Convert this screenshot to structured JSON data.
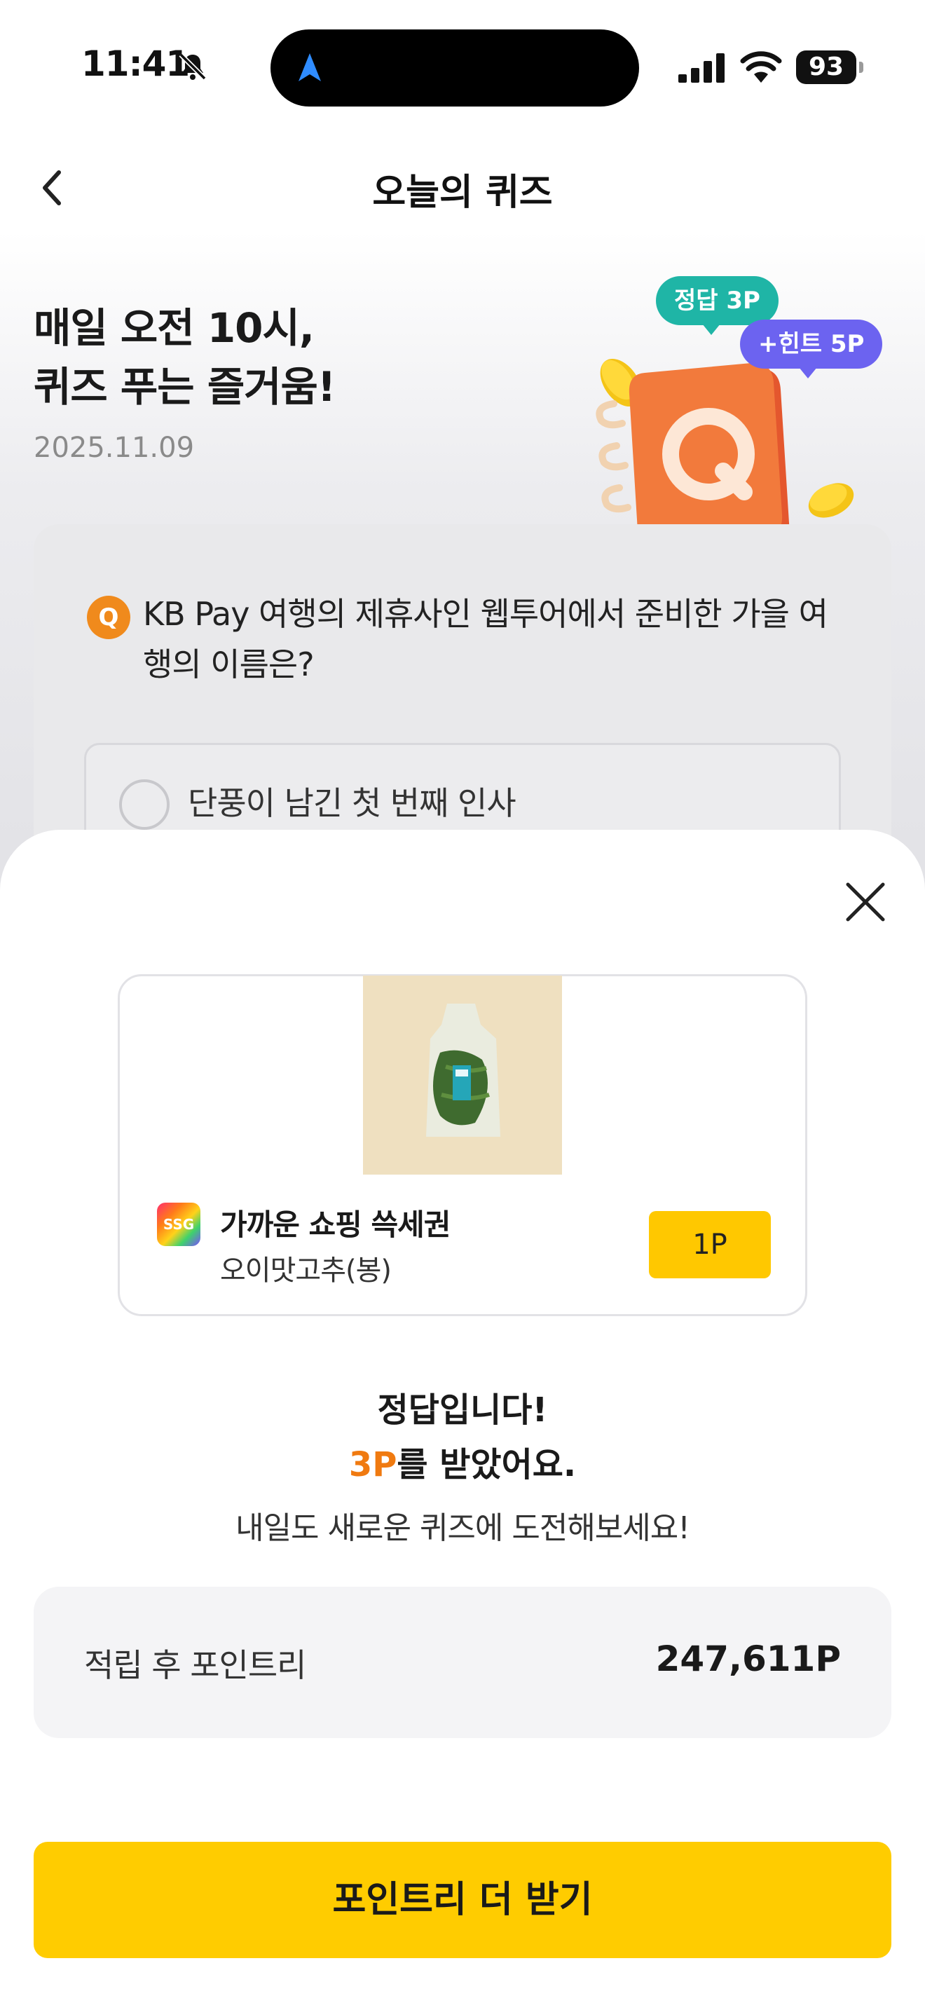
{
  "status_bar": {
    "time": "11:41",
    "battery": "93"
  },
  "header": {
    "title": "오늘의 퀴즈"
  },
  "hero": {
    "title_line1": "매일 오전 10시,",
    "title_line2": "퀴즈 푸는 즐거움!",
    "date": "2025.11.09",
    "bubble_answer": "정답 3P",
    "bubble_hint": "+힌트 5P",
    "book_letter": "Q"
  },
  "quiz": {
    "badge": "Q",
    "question": "KB Pay 여행의 제휴사인 웹투어에서 준비한 가을 여행의 이름은?",
    "option_1": "단풍이 남긴 첫 번째 인사"
  },
  "reward": {
    "logo_text": "SSG",
    "brand": "가까운 쇼핑 쓱세권",
    "product": "오이맛고추(봉)",
    "price": "1P"
  },
  "result": {
    "line1": "정답입니다!",
    "points": "3P",
    "line2_suffix": "를 받았어요.",
    "line3": "내일도 새로운 퀴즈에 도전해보세요!"
  },
  "points_summary": {
    "label": "적립 후 포인트리",
    "value": "247,611P"
  },
  "cta": {
    "label": "포인트리 더 받기"
  },
  "icons": {
    "back": "chevron-left-icon",
    "close": "close-icon",
    "bell": "bell-slash-icon",
    "location": "navigation-arrow-icon",
    "signal": "signal-icon",
    "wifi": "wifi-icon"
  },
  "colors": {
    "accent_yellow": "#ffcc00",
    "points_orange": "#f07a10",
    "bubble_green": "#1fb5a6",
    "bubble_purple": "#6c63f0",
    "quiz_badge": "#f08a1c"
  }
}
